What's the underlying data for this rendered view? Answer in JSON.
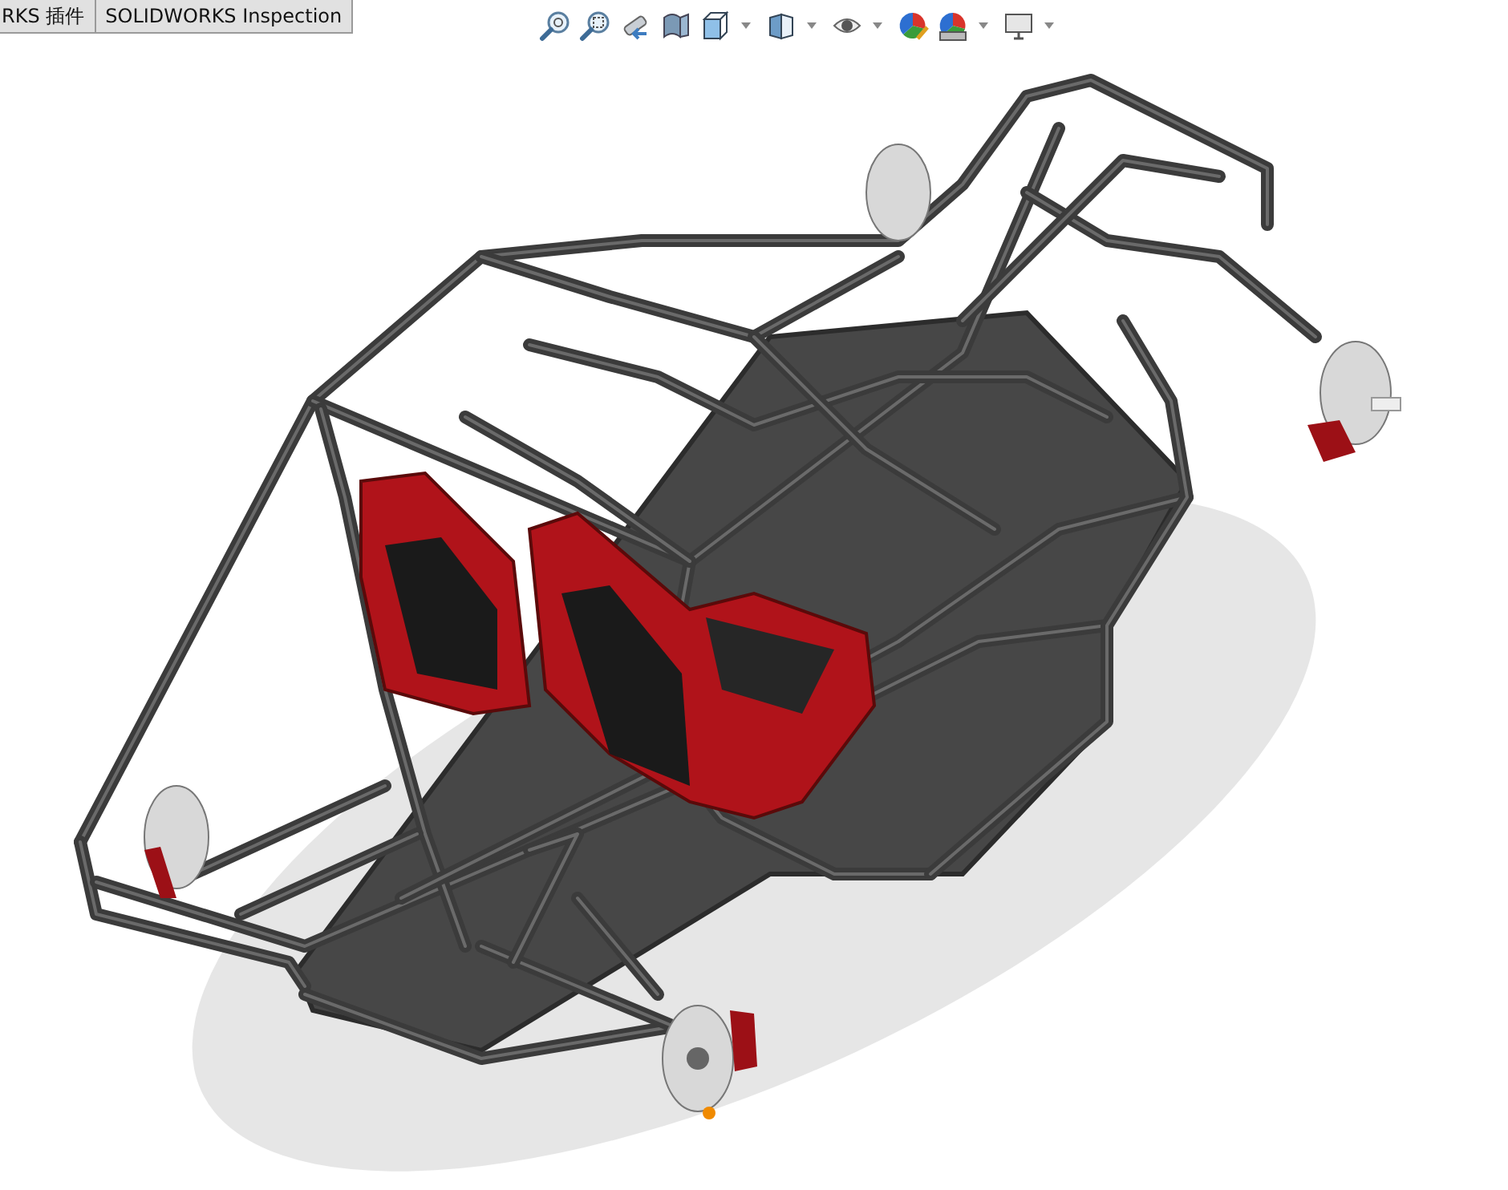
{
  "tabs": [
    {
      "label": "RKS 插件"
    },
    {
      "label": "SOLIDWORKS Inspection"
    }
  ],
  "toolbar": [
    {
      "kind": "zoom-fit",
      "dropdown": false
    },
    {
      "kind": "zoom-area",
      "dropdown": false
    },
    {
      "kind": "previous-view",
      "dropdown": false
    },
    {
      "kind": "section",
      "dropdown": false
    },
    {
      "kind": "orientation",
      "dropdown": true
    },
    {
      "kind": "display-style",
      "dropdown": true
    },
    {
      "kind": "hide-show",
      "dropdown": true
    },
    {
      "kind": "appearance",
      "dropdown": false
    },
    {
      "kind": "scene",
      "dropdown": true
    },
    {
      "kind": "monitor",
      "dropdown": true
    }
  ]
}
